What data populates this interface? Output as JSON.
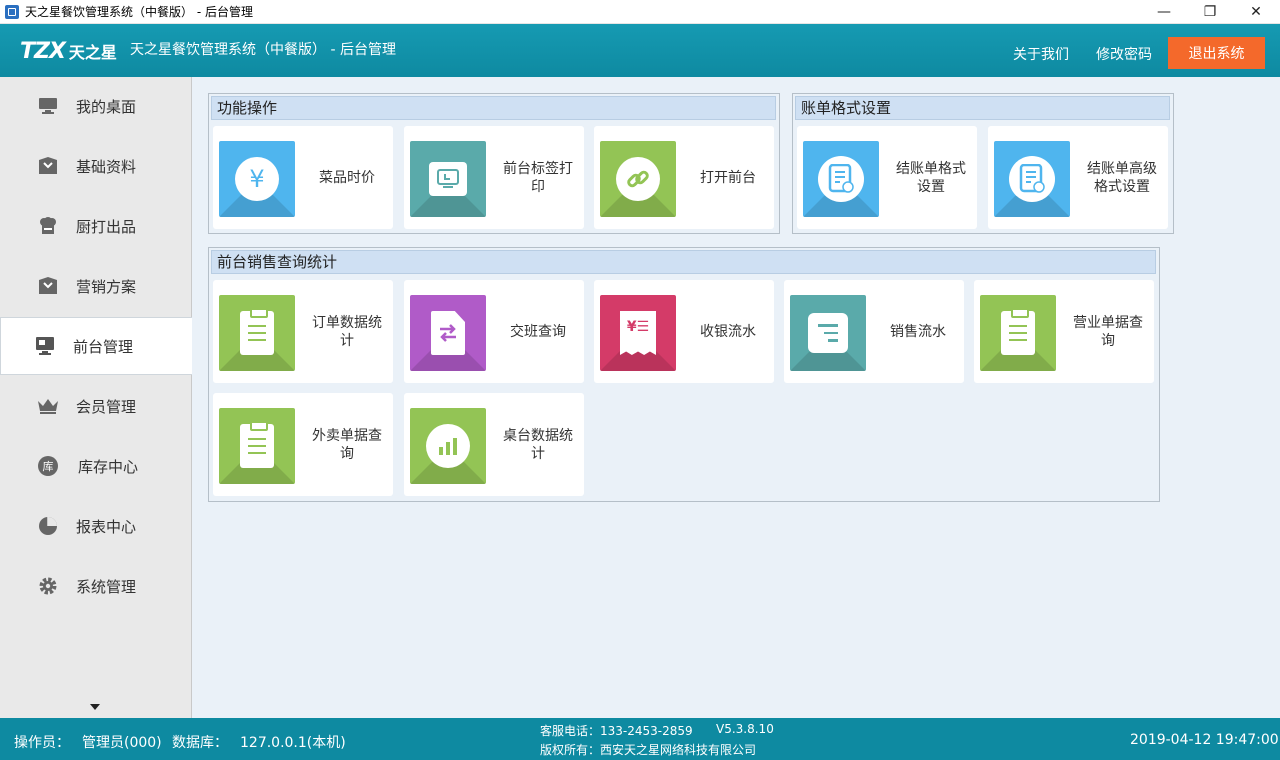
{
  "window": {
    "title": "天之星餐饮管理系统（中餐版） - 后台管理",
    "minimize_glyph": "—",
    "maximize_glyph": "❐",
    "close_glyph": "✕"
  },
  "header": {
    "logo_mark": "TZX",
    "logo_text": "天之星",
    "title": "天之星餐饮管理系统（中餐版） - 后台管理",
    "about_label": "关于我们",
    "change_password_label": "修改密码",
    "logout_label": "退出系统",
    "logout_color": "#f4692b",
    "bar_color": "#0e8aa1"
  },
  "sidebar": {
    "items": [
      {
        "label": "我的桌面",
        "icon": "desktop-icon"
      },
      {
        "label": "基础资料",
        "icon": "box-icon"
      },
      {
        "label": "厨打出品",
        "icon": "chef-hat-icon"
      },
      {
        "label": "营销方案",
        "icon": "box-icon"
      },
      {
        "label": "前台管理",
        "icon": "monitor-icon",
        "active": true
      },
      {
        "label": "会员管理",
        "icon": "crown-icon"
      },
      {
        "label": "库存中心",
        "icon": "warehouse-icon",
        "glyph": "库"
      },
      {
        "label": "报表中心",
        "icon": "pie-chart-icon"
      },
      {
        "label": "系统管理",
        "icon": "gear-icon"
      }
    ]
  },
  "panels": {
    "functions": {
      "title": "功能操作",
      "tiles": [
        {
          "label": "菜品时价",
          "icon": "yen-coin-icon",
          "color": "#4fb5ee"
        },
        {
          "label": "前台标签打印",
          "icon": "label-print-icon",
          "color": "#5aaaaa"
        },
        {
          "label": "打开前台",
          "icon": "link-icon",
          "color": "#93c455"
        }
      ]
    },
    "bill_format": {
      "title": "账单格式设置",
      "tiles": [
        {
          "label": "结账单格式设置",
          "icon": "bill-format-icon",
          "color": "#4fb5ee"
        },
        {
          "label": "结账单高级格式设置",
          "icon": "bill-advanced-icon",
          "color": "#4fb5ee"
        }
      ]
    },
    "sales_stats": {
      "title": "前台销售查询统计",
      "tiles": [
        {
          "label": "订单数据统计",
          "icon": "clipboard-icon",
          "color": "#93c455"
        },
        {
          "label": "交班查询",
          "icon": "shift-exchange-icon",
          "color": "#b05bc8"
        },
        {
          "label": "收银流水",
          "icon": "receipt-icon",
          "color": "#d43b68"
        },
        {
          "label": "销售流水",
          "icon": "list-icon",
          "color": "#5aaaaa"
        },
        {
          "label": "营业单据查询",
          "icon": "clipboard-icon",
          "color": "#93c455"
        },
        {
          "label": "外卖单据查询",
          "icon": "clipboard-icon",
          "color": "#93c455"
        },
        {
          "label": "桌台数据统计",
          "icon": "bar-chart-icon",
          "color": "#93c455"
        }
      ]
    }
  },
  "statusbar": {
    "operator_label": "操作员：",
    "operator_value": "管理员(000)",
    "database_label": "数据库：",
    "database_value": "127.0.0.1(本机)",
    "service_phone": "客服电话：133-2453-2859",
    "version": "V5.3.8.10",
    "copyright": "版权所有：西安天之星网络科技有限公司",
    "datetime": "2019-04-12 19:47:00"
  }
}
